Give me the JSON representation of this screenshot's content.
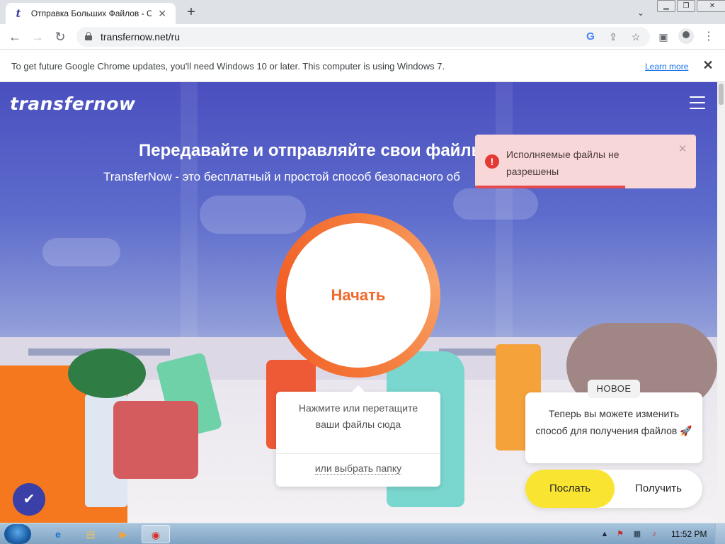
{
  "browser": {
    "tab": {
      "title": "Отправка Больших Файлов - Об",
      "favicon": "t"
    },
    "address": {
      "url": "transfernow.net/ru"
    },
    "infobar": {
      "message": "To get future Google Chrome updates, you'll need Windows 10 or later. This computer is using Windows 7.",
      "link": "Learn more"
    }
  },
  "site": {
    "logo": "transfernow",
    "headline": "Передавайте и отправляйте свои файлы",
    "subline": "TransferNow - это бесплатный и простой способ безопасного об",
    "start_label": "Начать",
    "drop": {
      "hint": "Нажмите или перетащите ваши файлы сюда",
      "folder_link": "или выбрать папку"
    },
    "toast": {
      "message": "Исполняемые файлы не разрешены",
      "progress": 0.68,
      "color": "#e5484d"
    },
    "new_feature": {
      "badge": "НОВОЕ",
      "text": "Теперь вы можете изменить способ для получения файлов 🚀"
    },
    "mode": {
      "send": "Послать",
      "receive": "Получить",
      "selected": "send"
    },
    "colors": {
      "brand": "#3b3fa8",
      "accent": "#f06a2d",
      "send": "#f9e531"
    }
  },
  "taskbar": {
    "clock": "11:52 PM"
  }
}
